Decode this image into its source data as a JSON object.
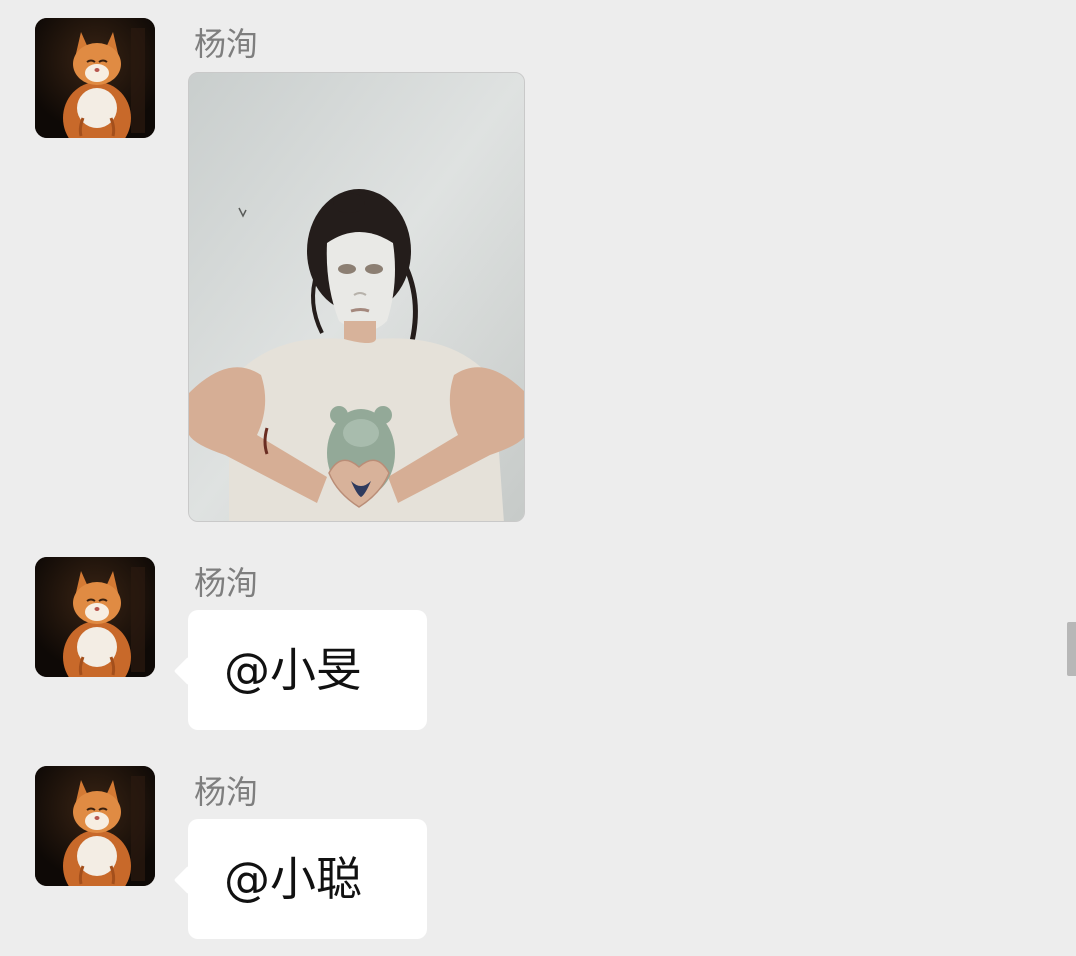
{
  "messages": [
    {
      "sender": "杨洵",
      "type": "image",
      "avatar_icon": "cat-avatar",
      "image_desc_icon": "photo-face-mask-heart-hands"
    },
    {
      "sender": "杨洵",
      "type": "text",
      "avatar_icon": "cat-avatar",
      "text": "@小旻"
    },
    {
      "sender": "杨洵",
      "type": "text",
      "avatar_icon": "cat-avatar",
      "text": "@小聪"
    }
  ],
  "colors": {
    "background": "#ededed",
    "bubble": "#ffffff",
    "sender_name": "#7e7e7e",
    "message_text": "#111111",
    "scrollbar": "#b7b7b7"
  }
}
